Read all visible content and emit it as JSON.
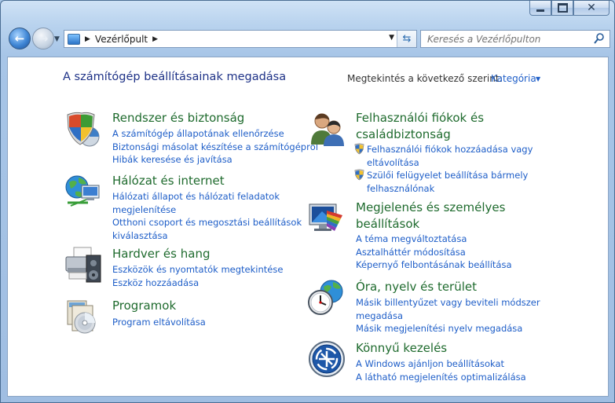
{
  "window": {
    "close_glyph": "✕"
  },
  "nav": {
    "breadcrumb": [
      "Vezérlőpult"
    ],
    "search_placeholder": "Keresés a Vezérlőpulton"
  },
  "main": {
    "heading": "A számítógép beállításainak megadása",
    "view_by_label": "Megtekintés a következő szerint:",
    "view_by_value": "Kategória"
  },
  "categories": {
    "system": {
      "icon": "shield-icon",
      "title": "Rendszer és biztonság",
      "links": [
        "A számítógép állapotának ellenőrzése",
        "Biztonsági másolat készítése a számítógépről",
        "Hibák keresése és javítása"
      ]
    },
    "network": {
      "icon": "network-globe-icon",
      "title": "Hálózat és internet",
      "links": [
        "Hálózati állapot és hálózati feladatok megjelenítése",
        "Otthoni csoport és megosztási beállítások kiválasztása"
      ],
      "link_lines": [
        [
          "Hálózati állapot és hálózati feladatok",
          "megjelenítése"
        ],
        [
          "Otthoni csoport és megosztási beállítások",
          "kiválasztása"
        ]
      ]
    },
    "hardware": {
      "icon": "printer-icon",
      "title": "Hardver és hang",
      "links": [
        "Eszközök és nyomtatók megtekintése",
        "Eszköz hozzáadása"
      ]
    },
    "programs": {
      "icon": "programs-disc-icon",
      "title": "Programok",
      "links": [
        "Program eltávolítása"
      ]
    },
    "users": {
      "icon": "users-icon",
      "title_lines": [
        "Felhasználói fiókok és",
        "családbiztonság"
      ],
      "link_lines": [
        [
          "Felhasználói fiókok hozzáadása vagy",
          "eltávolítása"
        ],
        [
          "Szülői felügyelet beállítása bármely",
          "felhasználónak"
        ]
      ]
    },
    "appearance": {
      "icon": "monitor-palette-icon",
      "title_lines": [
        "Megjelenés és személyes",
        "beállítások"
      ],
      "links": [
        "A téma megváltoztatása",
        "Asztalháttér módosítása",
        "Képernyő felbontásának beállítása"
      ]
    },
    "clock": {
      "icon": "clock-globe-icon",
      "title": "Óra, nyelv és terület",
      "link_lines": [
        [
          "Másik billentyűzet vagy beviteli módszer",
          "megadása"
        ],
        [
          "Másik megjelenítési nyelv megadása"
        ]
      ]
    },
    "ease": {
      "icon": "ease-of-access-icon",
      "title": "Könnyű kezelés",
      "links": [
        "A Windows ajánljon beállításokat",
        "A látható megjelenítés optimalizálása"
      ]
    }
  }
}
